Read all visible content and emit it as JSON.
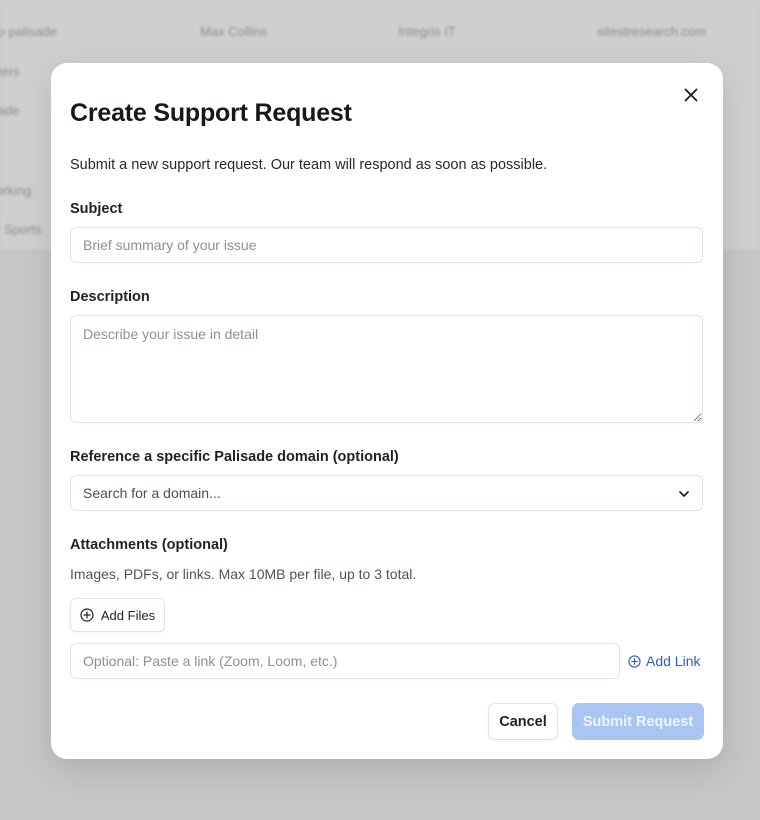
{
  "background": {
    "rows": [
      {
        "c1": "to palisade",
        "c2": "Max Collins",
        "c3": "Integris IT",
        "c4": "sitestresearch.com"
      },
      {
        "c1": "ters",
        "c2": "",
        "c3": "",
        "c4": ""
      },
      {
        "c1": "ade",
        "c2": "",
        "c3": "",
        "c4": ""
      },
      {
        "c1": "orking",
        "c2": "",
        "c3": "",
        "c4": ""
      },
      {
        "c1": "r Sports",
        "c2": "",
        "c3": "",
        "c4": ""
      }
    ]
  },
  "modal": {
    "title": "Create Support Request",
    "description": "Submit a new support request. Our team will respond as soon as possible.",
    "subject": {
      "label": "Subject",
      "value": "",
      "placeholder": "Brief summary of your issue"
    },
    "details": {
      "label": "Description",
      "value": "",
      "placeholder": "Describe your issue in detail"
    },
    "domain": {
      "label": "Reference a specific Palisade domain (optional)",
      "placeholder": "Search for a domain..."
    },
    "attachments": {
      "label": "Attachments (optional)",
      "hint": "Images, PDFs, or links. Max 10MB per file, up to 3 total.",
      "add_files_label": "Add Files",
      "link_placeholder": "Optional: Paste a link (Zoom, Loom, etc.)",
      "add_link_label": "Add Link"
    },
    "actions": {
      "cancel_label": "Cancel",
      "submit_label": "Submit Request"
    }
  },
  "icons": {
    "close": "close-icon",
    "chevron": "chevron-down-icon",
    "add_files": "plus-circle-icon",
    "add_link": "plus-circle-icon"
  },
  "colors": {
    "overlay": "#c9c9c9",
    "primary_disabled": "#a9c6f3",
    "link": "#2f5fb0",
    "border": "#dfe2e7"
  }
}
